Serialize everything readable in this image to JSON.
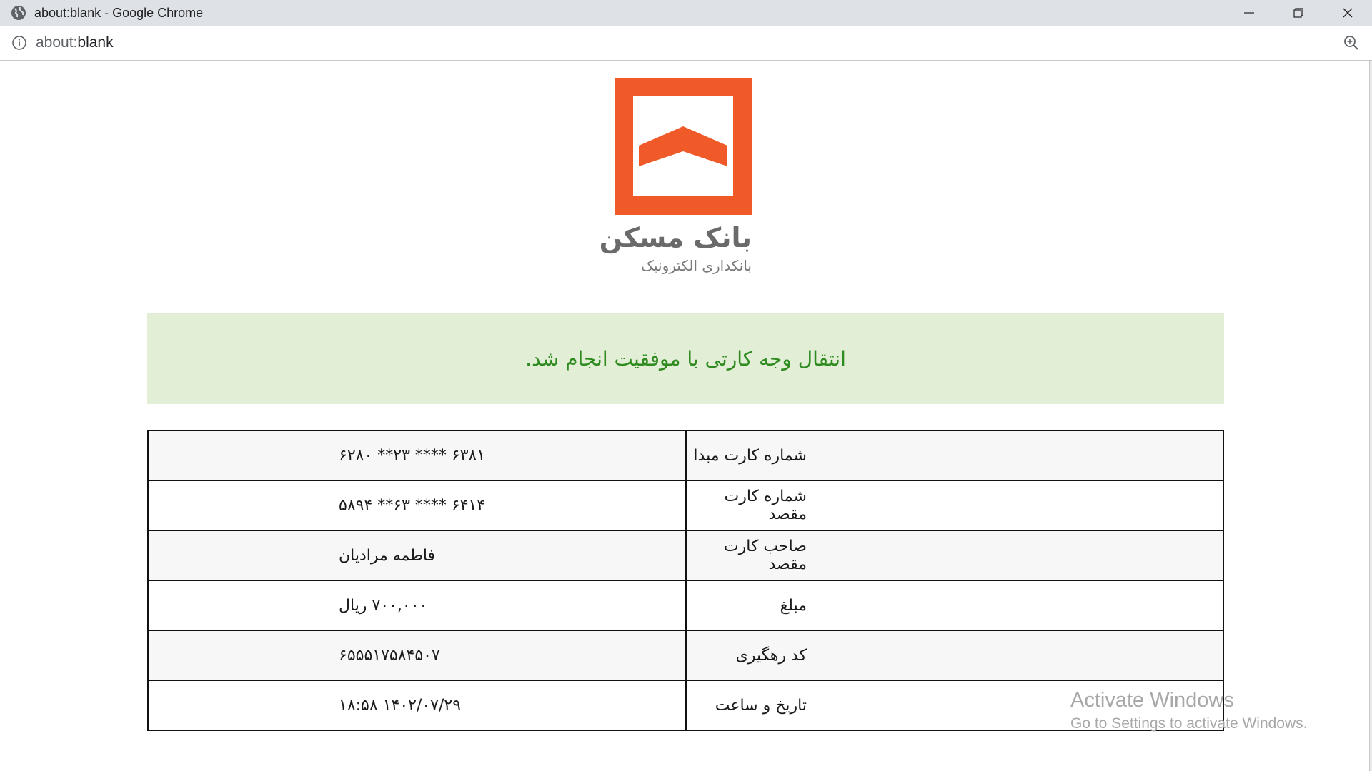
{
  "browser": {
    "window_title": "about:blank - Google Chrome",
    "url_scheme": "about:",
    "url_path": "blank"
  },
  "page": {
    "bank_name": "بانک مسکن",
    "bank_subtitle": "بانکداری الکترونیک",
    "success_message": "انتقال وجه کارتی با موفقیت انجام شد.",
    "logo_color": "#f05a28",
    "success_color": "#2e8b1f",
    "banner_bg": "#e3eed6"
  },
  "details": [
    {
      "label": "شماره کارت مبدا",
      "value": "۶۳۸۱ **** ۲۳** ۶۲۸۰"
    },
    {
      "label": "شماره کارت مقصد",
      "value": "۶۴۱۴ **** ۶۳** ۵۸۹۴"
    },
    {
      "label": "صاحب کارت مقصد",
      "value": "فاطمه مرادیان"
    },
    {
      "label": "مبلغ",
      "value": "۷۰۰,۰۰۰ ریال"
    },
    {
      "label": "کد رهگیری",
      "value": "۶۵۵۵۱۷۵۸۴۵۰۷"
    },
    {
      "label": "تاریخ و ساعت",
      "value": "۱۴۰۲/۰۷/۲۹ ۱۸:۵۸"
    }
  ],
  "watermark": {
    "line1": "Activate Windows",
    "line2": "Go to Settings to activate Windows."
  }
}
